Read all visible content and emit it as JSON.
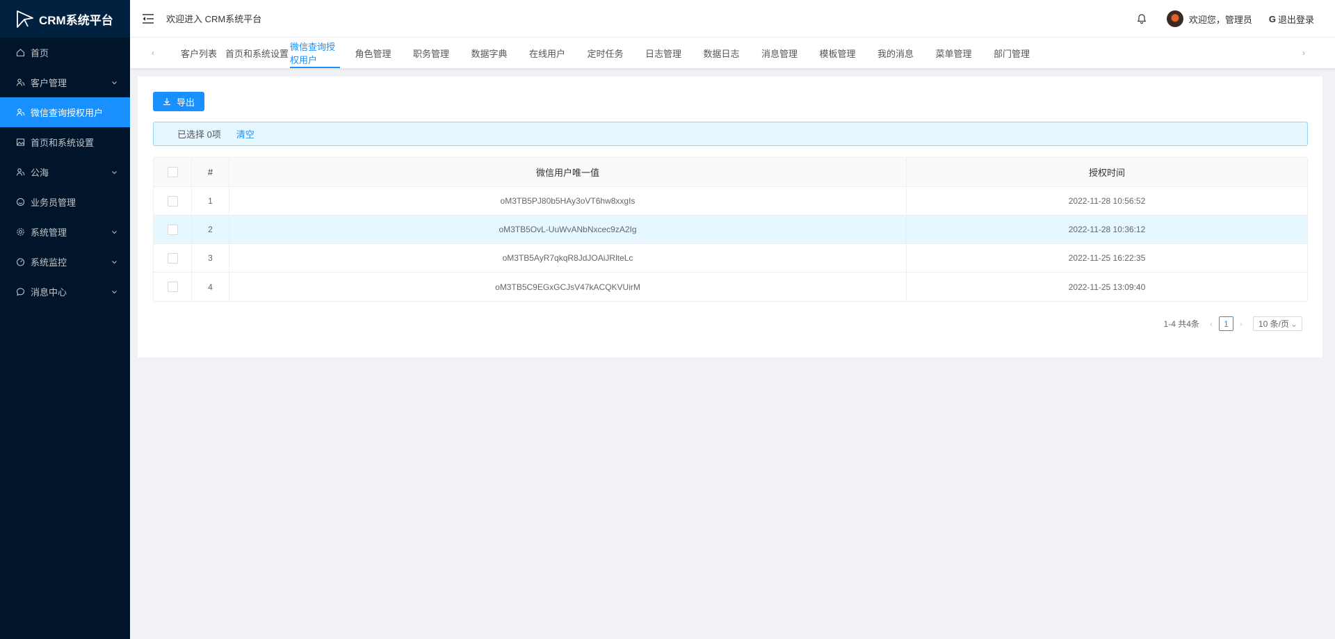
{
  "sidebar": {
    "logo_text": "CRM系统平台",
    "items": [
      {
        "label": "首页",
        "icon": "home-icon",
        "has_arrow": false,
        "active": false
      },
      {
        "label": "客户管理",
        "icon": "users-icon",
        "has_arrow": true,
        "active": false
      },
      {
        "label": "微信查询授权用户",
        "icon": "users-icon",
        "has_arrow": false,
        "active": true
      },
      {
        "label": "首页和系统设置",
        "icon": "image-icon",
        "has_arrow": false,
        "active": false
      },
      {
        "label": "公海",
        "icon": "users-icon",
        "has_arrow": true,
        "active": false
      },
      {
        "label": "业务员管理",
        "icon": "smile-icon",
        "has_arrow": false,
        "active": false
      },
      {
        "label": "系统管理",
        "icon": "gear-icon",
        "has_arrow": true,
        "active": false
      },
      {
        "label": "系统监控",
        "icon": "dashboard-icon",
        "has_arrow": true,
        "active": false
      },
      {
        "label": "消息中心",
        "icon": "message-icon",
        "has_arrow": true,
        "active": false
      }
    ]
  },
  "header": {
    "welcome": "欢迎进入 CRM系统平台",
    "user_greeting": "欢迎您，管理员",
    "logout_label": "退出登录"
  },
  "tabs": {
    "items": [
      "客户列表",
      "首页和系统设置",
      "微信查询授权用户",
      "角色管理",
      "职务管理",
      "数据字典",
      "在线用户",
      "定时任务",
      "日志管理",
      "数据日志",
      "消息管理",
      "模板管理",
      "我的消息",
      "菜单管理",
      "部门管理"
    ],
    "active_index": 2
  },
  "toolbar": {
    "export_label": "导出"
  },
  "selection": {
    "text": "已选择 0项",
    "clear_label": "清空"
  },
  "table": {
    "columns": [
      "#",
      "微信用户唯一值",
      "授权时间"
    ],
    "rows": [
      {
        "index": "1",
        "openid": "oM3TB5PJ80b5HAy3oVT6hw8xxgIs",
        "time": "2022-11-28 10:56:52"
      },
      {
        "index": "2",
        "openid": "oM3TB5OvL-UuWvANbNxcec9zA2Ig",
        "time": "2022-11-28 10:36:12"
      },
      {
        "index": "3",
        "openid": "oM3TB5AyR7qkqR8JdJOAiJRlteLc",
        "time": "2022-11-25 16:22:35"
      },
      {
        "index": "4",
        "openid": "oM3TB5C9EGxGCJsV47kACQKVUirM",
        "time": "2022-11-25 13:09:40"
      }
    ],
    "highlighted_row": 2
  },
  "pagination": {
    "total_text": "1-4 共4条",
    "current_page": "1",
    "page_size": "10 条/页"
  }
}
